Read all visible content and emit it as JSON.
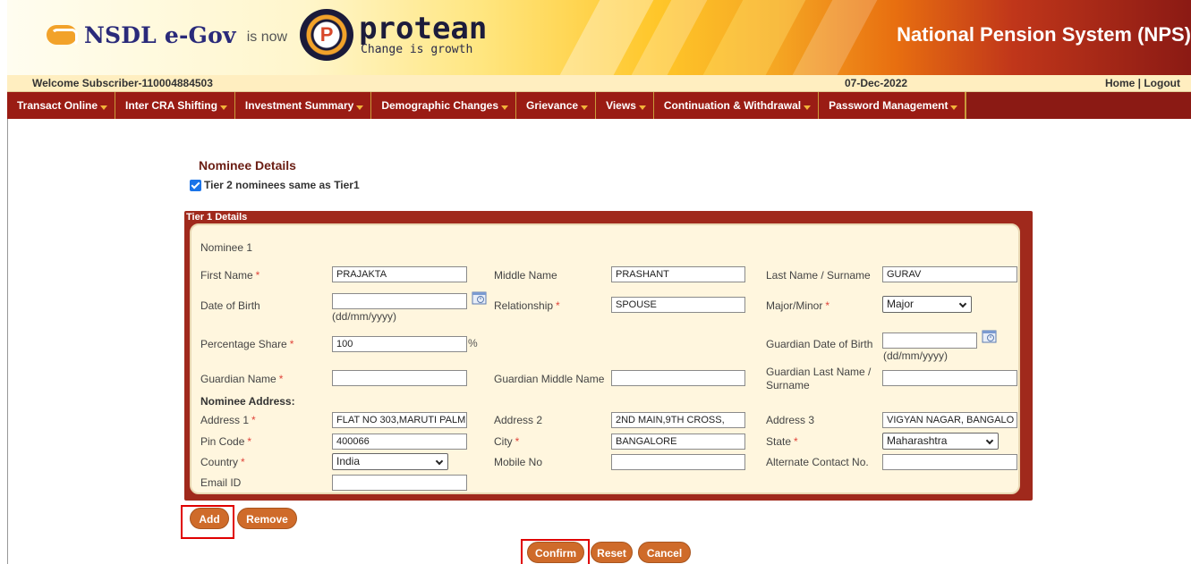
{
  "header": {
    "brand": "NSDL e-Gov",
    "is_now": "is now",
    "protean_name": "protean",
    "protean_tagline": "Change is growth",
    "system_title": "National Pension System (NPS)"
  },
  "welcome": {
    "user": "Welcome Subscriber-110004884503",
    "date": "07-Dec-2022",
    "links": "Home | Logout"
  },
  "menu": [
    {
      "label": "Transact Online"
    },
    {
      "label": "Inter CRA Shifting"
    },
    {
      "label": "Investment Summary"
    },
    {
      "label": "Demographic Changes"
    },
    {
      "label": "Grievance"
    },
    {
      "label": "Views"
    },
    {
      "label": "Continuation & Withdrawal"
    },
    {
      "label": "Password Management"
    }
  ],
  "page": {
    "title": "Nominee Details",
    "same_as_tier1_label": "Tier 2 nominees same as Tier1",
    "same_as_tier1_checked": true
  },
  "panel": {
    "header": "Tier 1 Details",
    "nominee_heading": "Nominee  1",
    "labels": {
      "first_name": "First Name",
      "middle_name": "Middle Name",
      "last_name": "Last Name / Surname",
      "dob": "Date of Birth",
      "date_format": "(dd/mm/yyyy)",
      "relationship": "Relationship",
      "major_minor": "Major/Minor",
      "percentage_share": "Percentage Share",
      "percent_sign": "%",
      "guardian_dob": "Guardian Date of Birth",
      "guardian_name": "Guardian Name",
      "guardian_middle_name": "Guardian Middle Name",
      "guardian_last_name_l1": "Guardian Last Name /",
      "guardian_last_name_l2": "Surname",
      "nominee_address": "Nominee Address:",
      "address1": "Address 1",
      "address2": "Address 2",
      "address3": "Address 3",
      "pin_code": "Pin Code",
      "city": "City",
      "state": "State",
      "country": "Country",
      "mobile": "Mobile No",
      "alt_contact": "Alternate Contact No.",
      "email": "Email ID",
      "required_mark": "*"
    },
    "values": {
      "first_name": "PRAJAKTA",
      "middle_name": "PRASHANT",
      "last_name": "GURAV",
      "dob": "",
      "relationship": "SPOUSE",
      "major_minor": "Major",
      "percentage_share": "100",
      "guardian_dob": "",
      "guardian_name": "",
      "guardian_middle_name": "",
      "guardian_last_name": "",
      "address1": "FLAT NO 303,MARUTI PALM",
      "address2": "2ND MAIN,9TH CROSS,",
      "address3": "VIGYAN NAGAR, BANGALO",
      "pin_code": "400066",
      "city": "BANGALORE",
      "state": "Maharashtra",
      "country": "India",
      "mobile": "",
      "alt_contact": "",
      "email": ""
    }
  },
  "buttons": {
    "add": "Add",
    "remove": "Remove",
    "confirm": "Confirm",
    "reset": "Reset",
    "cancel": "Cancel"
  },
  "colors": {
    "menu_bg": "#8b1a14",
    "button_bg": "#cf6b2a",
    "panel_bg": "#a0291c",
    "panel_body": "#fff6de",
    "title_color": "#6b1e14",
    "highlight": "#e00000"
  }
}
